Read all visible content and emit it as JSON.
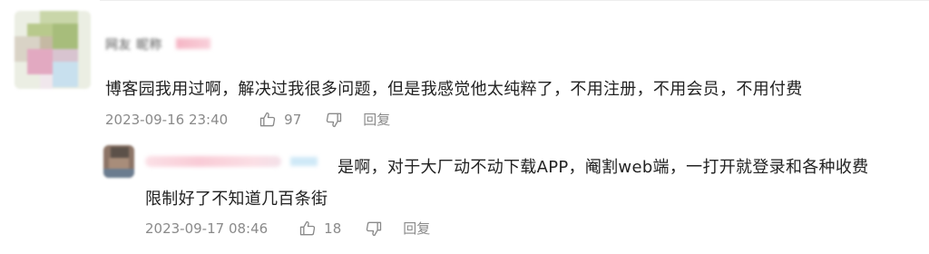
{
  "main_comment": {
    "username": "网友 昵称",
    "text": "博客园我用过啊，解决过我很多问题，但是我感觉他太纯粹了，不用注册，不用会员，不用付费",
    "time": "2023-09-16 23:40",
    "likes": "97",
    "reply_label": "回复",
    "icons": {
      "like": "thumbs-up-icon",
      "dislike": "thumbs-down-icon"
    }
  },
  "reply_comment": {
    "text_line1": "是啊，对于大厂动不动下载APP，阉割web端，一打开就登录和各种收费",
    "text_line2": "限制好了不知道几百条街",
    "time": "2023-09-17 08:46",
    "likes": "18",
    "reply_label": "回复"
  },
  "colors": {
    "text": "#222222",
    "meta": "#8a8a8a",
    "background": "#ffffff"
  }
}
